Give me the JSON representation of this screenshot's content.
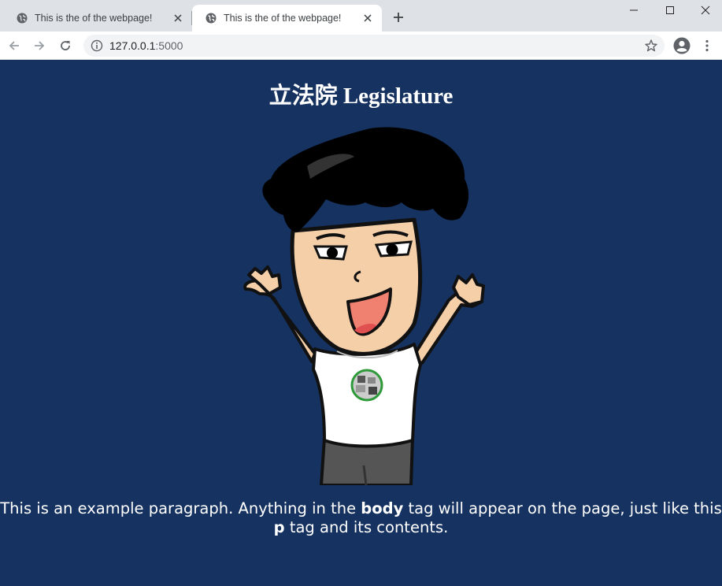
{
  "browser": {
    "tabs": [
      {
        "title": "This is the of the webpage!",
        "active": false
      },
      {
        "title": "This is the of the webpage!",
        "active": true
      }
    ],
    "url_host": "127.0.0.1",
    "url_port": ":5000"
  },
  "page": {
    "heading": "立法院 Legislature",
    "paragraph": {
      "part1": "This is an example paragraph. Anything in the ",
      "bold1": "body",
      "part2": " tag will appear on the page, just like this ",
      "bold2": "p",
      "part3": " tag and its contents."
    },
    "background_color": "#163260",
    "text_color": "#ffffff"
  },
  "icons": {
    "tab_favicon": "globe-icon",
    "tab_close": "close-icon",
    "new_tab": "plus-icon",
    "back": "arrow-left-icon",
    "forward": "arrow-right-icon",
    "reload": "reload-icon",
    "site_info": "info-icon",
    "bookmark": "star-icon",
    "profile": "account-icon",
    "menu": "kebab-menu-icon",
    "window_min": "minimize-icon",
    "window_max": "maximize-icon",
    "window_close": "close-icon"
  }
}
